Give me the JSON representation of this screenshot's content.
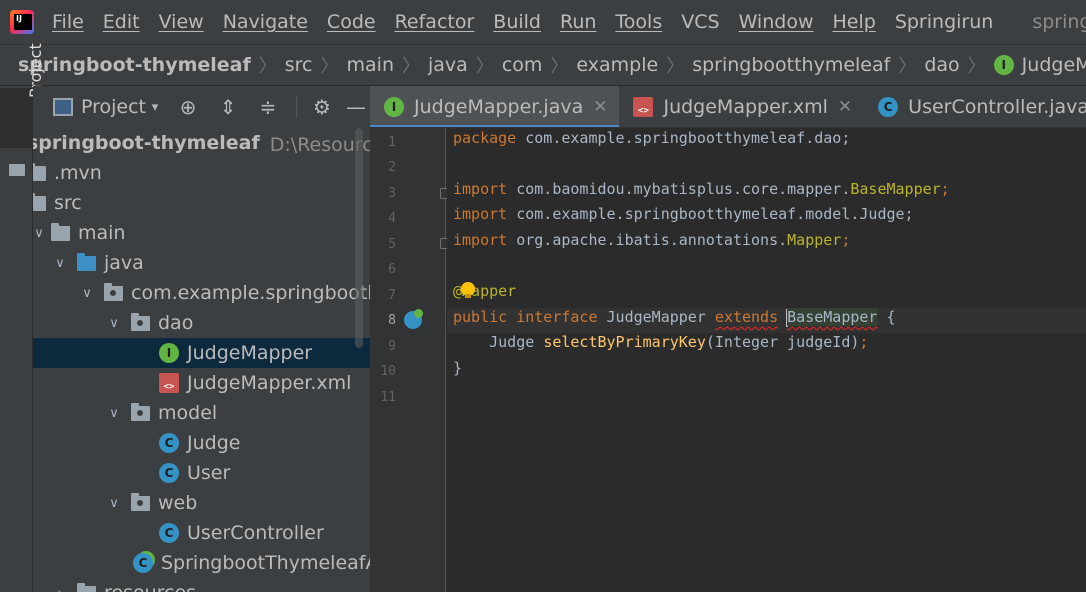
{
  "menu": {
    "items": [
      "File",
      "Edit",
      "View",
      "Navigate",
      "Code",
      "Refactor",
      "Build",
      "Run",
      "Tools",
      "VCS",
      "Window",
      "Help",
      "Springirun"
    ],
    "window_title": "springboot-t"
  },
  "breadcrumb": [
    "springboot-thymeleaf",
    "src",
    "main",
    "java",
    "com",
    "example",
    "springbootthymeleaf",
    "dao",
    "JudgeMapper"
  ],
  "tool_strip": {
    "project_label": "Project"
  },
  "project_panel": {
    "title": "Project",
    "tree": [
      {
        "label": "springboot-thymeleaf",
        "extra": "D:\\Resource\\软件",
        "kind": "root"
      },
      {
        "label": ".mvn",
        "kind": "folder"
      },
      {
        "label": "src",
        "kind": "folder"
      },
      {
        "label": "main",
        "kind": "folder"
      },
      {
        "label": "java",
        "kind": "folder-blue"
      },
      {
        "label": "com.example.springboothy",
        "kind": "package"
      },
      {
        "label": "dao",
        "kind": "package"
      },
      {
        "label": "JudgeMapper",
        "kind": "interface"
      },
      {
        "label": "JudgeMapper.xml",
        "kind": "xml"
      },
      {
        "label": "model",
        "kind": "package"
      },
      {
        "label": "Judge",
        "kind": "class"
      },
      {
        "label": "User",
        "kind": "class"
      },
      {
        "label": "web",
        "kind": "package"
      },
      {
        "label": "UserController",
        "kind": "class"
      },
      {
        "label": "SpringbootThymeleafAp",
        "kind": "app"
      },
      {
        "label": "resources",
        "kind": "folder"
      }
    ]
  },
  "tabs": [
    {
      "label": "JudgeMapper.java",
      "icon": "interface-icon",
      "active": true
    },
    {
      "label": "JudgeMapper.xml",
      "icon": "xml-icon",
      "active": false
    },
    {
      "label": "UserController.java",
      "icon": "class-icon",
      "active": false
    }
  ],
  "editor": {
    "line_numbers": [
      "1",
      "2",
      "3",
      "4",
      "5",
      "6",
      "7",
      "8",
      "9",
      "10",
      "11"
    ],
    "code": {
      "l1_kw": "package",
      "l1_rest": " com.example.springbootthymeleaf.dao;",
      "l3_kw": "import",
      "l3_rest": " com.baomidou.mybatisplus.core.mapper.",
      "l3_type": "BaseMapper",
      "l3_end": ";",
      "l4_kw": "import",
      "l4_rest": " com.example.springbootthymeleaf.model.Judge;",
      "l5_kw": "import",
      "l5_rest": " org.apache.ibatis.annotations.",
      "l5_type": "Mapper",
      "l5_end": ";",
      "l7_ann": "@Mapper",
      "l8_kw1": "public",
      "l8_kw2": "interface",
      "l8_name": " JudgeMapper ",
      "l8_extends": "extends",
      "l8_base": "BaseMapper",
      "l8_end": " {",
      "l9_indent": "    Judge ",
      "l9_method": "selectByPrimaryKey",
      "l9_rest": "(Integer judgeId)",
      "l9_end": ";",
      "l10": "}"
    }
  }
}
